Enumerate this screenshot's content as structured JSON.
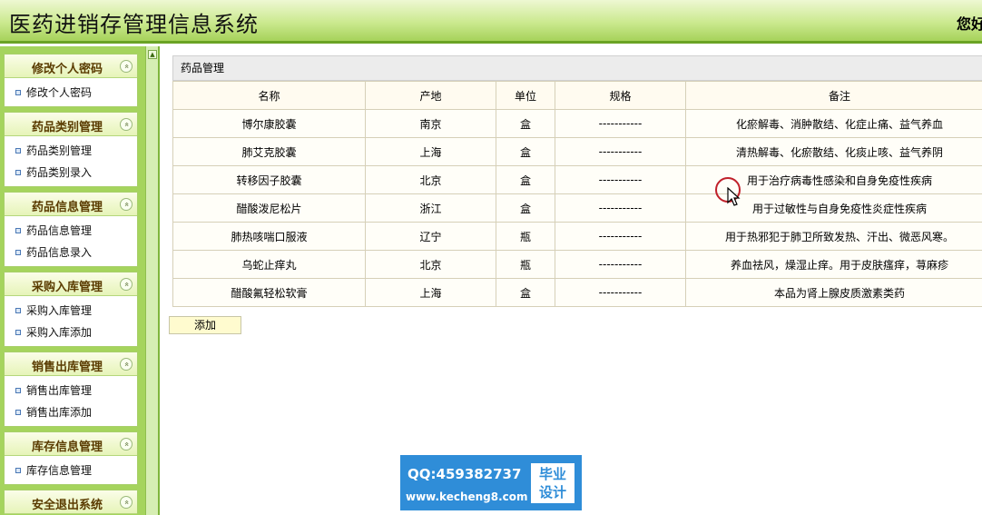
{
  "header": {
    "title": "医药进销存管理信息系统",
    "greeting": "您好"
  },
  "sidebar": {
    "groups": [
      {
        "title": "修改个人密码",
        "items": [
          "修改个人密码"
        ]
      },
      {
        "title": "药品类别管理",
        "items": [
          "药品类别管理",
          "药品类别录入"
        ]
      },
      {
        "title": "药品信息管理",
        "items": [
          "药品信息管理",
          "药品信息录入"
        ]
      },
      {
        "title": "采购入库管理",
        "items": [
          "采购入库管理",
          "采购入库添加"
        ]
      },
      {
        "title": "销售出库管理",
        "items": [
          "销售出库管理",
          "销售出库添加"
        ]
      },
      {
        "title": "库存信息管理",
        "items": [
          "库存信息管理"
        ]
      },
      {
        "title": "安全退出系统",
        "items": []
      }
    ],
    "collapse_glyph": "«"
  },
  "splitter": {
    "arrow_glyph": "▲"
  },
  "main": {
    "panel_title": "药品管理",
    "table": {
      "columns": [
        "名称",
        "产地",
        "单位",
        "规格",
        "备注"
      ],
      "rows": [
        [
          "博尔康胶囊",
          "南京",
          "盒",
          "-----------",
          "化瘀解毒、消肿散结、化症止痛、益气养血"
        ],
        [
          "肺艾克胶囊",
          "上海",
          "盒",
          "-----------",
          "清热解毒、化瘀散结、化痰止咳、益气养阴"
        ],
        [
          "转移因子胶囊",
          "北京",
          "盒",
          "-----------",
          "用于治疗病毒性感染和自身免疫性疾病"
        ],
        [
          "醋酸泼尼松片",
          "浙江",
          "盒",
          "-----------",
          "用于过敏性与自身免疫性炎症性疾病"
        ],
        [
          "肺热咳喘口服液",
          "辽宁",
          "瓶",
          "-----------",
          "用于热邪犯于肺卫所致发热、汗出、微恶风寒。"
        ],
        [
          "乌蛇止痒丸",
          "北京",
          "瓶",
          "-----------",
          "养血祛风，燥湿止痒。用于皮肤瘙痒，荨麻疹"
        ],
        [
          "醋酸氟轻松软膏",
          "上海",
          "盒",
          "-----------",
          "本品为肾上腺皮质激素类药"
        ]
      ]
    },
    "add_button_label": "添加"
  },
  "watermark": {
    "qq": "QQ:459382737",
    "url": "www.kecheng8.com",
    "badge_line1": "毕业",
    "badge_line2": "设计"
  },
  "colors": {
    "header_accent": "#6aa325",
    "sidebar_bg": "#a5d45d",
    "watermark_bg": "#2f8dd8",
    "cursor_ring": "#c0202a"
  }
}
